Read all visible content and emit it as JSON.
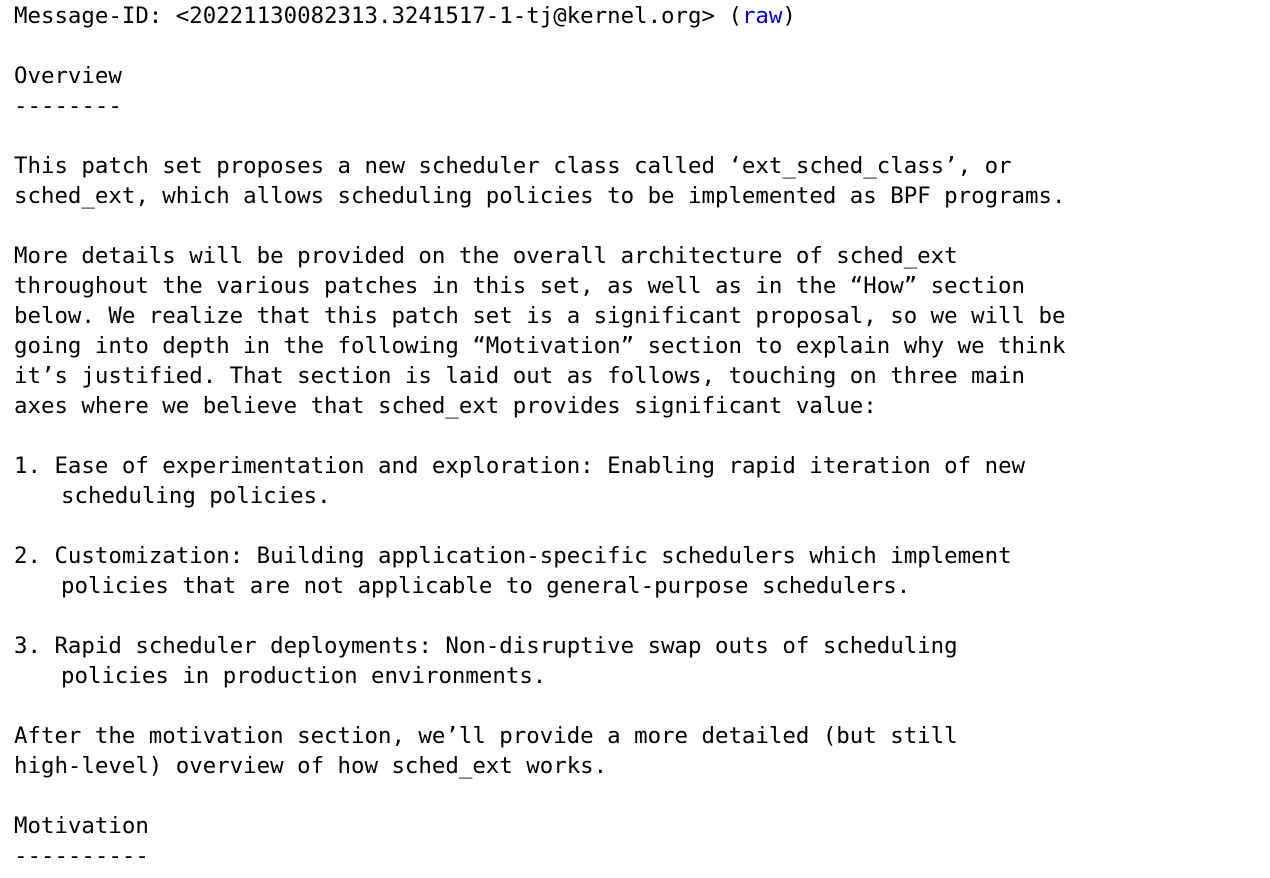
{
  "header": {
    "message_id_prefix": "Message-ID: <20221130082313.3241517-1-tj@kernel.org> (",
    "raw_link": "raw",
    "raw_suffix": ")"
  },
  "overview": {
    "heading": "Overview",
    "rule": "--------",
    "para1": [
      "This patch set proposes a new scheduler class called ‘ext_sched_class’, or",
      "sched_ext, which allows scheduling policies to be implemented as BPF programs."
    ],
    "para2": [
      "More details will be provided on the overall architecture of sched_ext",
      "throughout the various patches in this set, as well as in the “How” section",
      "below. We realize that this patch set is a significant proposal, so we will be",
      "going into depth in the following “Motivation” section to explain why we think",
      "it’s justified. That section is laid out as follows, touching on three main",
      "axes where we believe that sched_ext provides significant value:"
    ],
    "list": [
      {
        "marker": "1. ",
        "lines": [
          "Ease of experimentation and exploration: Enabling rapid iteration of new",
          "scheduling policies."
        ]
      },
      {
        "marker": "2. ",
        "lines": [
          "Customization: Building application-specific schedulers which implement",
          "policies that are not applicable to general-purpose schedulers."
        ]
      },
      {
        "marker": "3. ",
        "lines": [
          "Rapid scheduler deployments: Non-disruptive swap outs of scheduling",
          "policies in production environments."
        ]
      }
    ],
    "para3": [
      "After the motivation section, we’ll provide a more detailed (but still",
      "high-level) overview of how sched_ext works."
    ]
  },
  "motivation": {
    "heading": "Motivation",
    "rule": "----------"
  },
  "colors": {
    "text": "#000000",
    "link": "#0000ee",
    "background": "#ffffff"
  }
}
